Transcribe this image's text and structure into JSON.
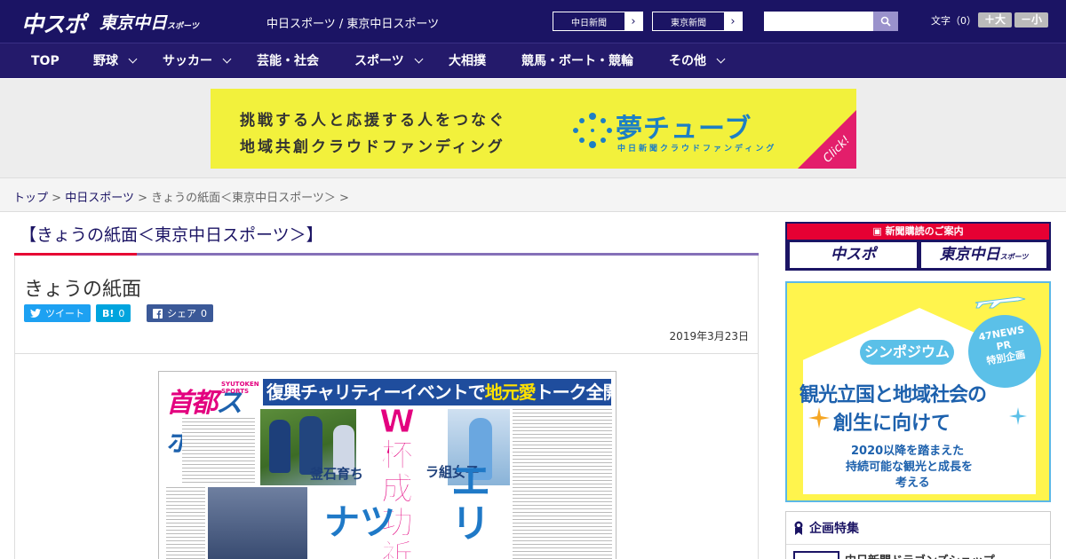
{
  "header": {
    "logo_chuspo": "中スポ",
    "logo_tokyo": "東京中日",
    "logo_tokyo_small": "スポーツ",
    "tagline": "中日スポーツ / 東京中日スポーツ",
    "link_chunichi": "中日新聞",
    "link_tokyo": "東京新聞",
    "search_placeholder": "",
    "font_size_label": "文字（0）",
    "font_larger": "＋大",
    "font_smaller": "－小"
  },
  "nav": [
    "TOP",
    "野球",
    "サッカー",
    "芸能・社会",
    "スポーツ",
    "大相撲",
    "競馬・ボート・競輪",
    "その他"
  ],
  "ad": {
    "line1": "挑戦する人と応援する人をつなぐ",
    "line2": "地域共創クラウドファンディング",
    "brand": "夢チューブ",
    "sub": "中日新聞クラウドファンディング",
    "click": "Click!",
    "colors": {
      "bg": "#f2f13c",
      "brand": "#1d7fc4",
      "corner": "#e31e6b"
    }
  },
  "breadcrumb": {
    "home": "トップ",
    "sep": ">",
    "section": "中日スポーツ",
    "current": "きょうの紙面＜東京中日スポーツ＞",
    "tail": ">"
  },
  "page": {
    "heading": "【きょうの紙面＜東京中日スポーツ＞】",
    "title": "きょうの紙面",
    "share_tweet": "ツイート",
    "share_hatena": "B!",
    "share_hatena_count": "0",
    "share_fb": "シェア",
    "share_fb_count": "0",
    "date": "2019年3月23日"
  },
  "newspaper": {
    "masthead_a": "首都",
    "masthead_b": "スポ",
    "masthead_small": "SYUTOKEN SPORTS",
    "headline": "復興チャリティーイベントで",
    "headline_em": "地元愛",
    "headline_tail": "トーク全開",
    "big_w": [
      "W",
      "杯",
      "成",
      "功",
      "祈"
    ],
    "label_a": "釜石育ち",
    "label_b": "ラ組女子",
    "big_natsu": "ナツ",
    "big_eri": "エリ"
  },
  "sidebar": {
    "subscribe_title": "新聞購読のご案内",
    "sub_chuspo": "中スポ",
    "sub_tokyo": "東京中日",
    "sub_tokyo_small": "スポーツ",
    "sympo_pill": "シンポジウム",
    "sympo_badge": [
      "47NEWS",
      "PR",
      "特別企画"
    ],
    "sympo_l1": "観光立国と地域社会の",
    "sympo_l2": "創生に向けて",
    "sympo_l3": "2020以降を踏まえた",
    "sympo_l4": "持続可能な観光と成長を",
    "sympo_l5": "考える",
    "kikaku_title": "企画特集",
    "kikaku_item": "中日新聞ドラゴンズショップ"
  },
  "colors": {
    "brand_navy": "#1b1464",
    "accent_red": "#e60033",
    "twitter": "#1da1f2",
    "hatena": "#00a4de",
    "facebook": "#3b5998"
  }
}
